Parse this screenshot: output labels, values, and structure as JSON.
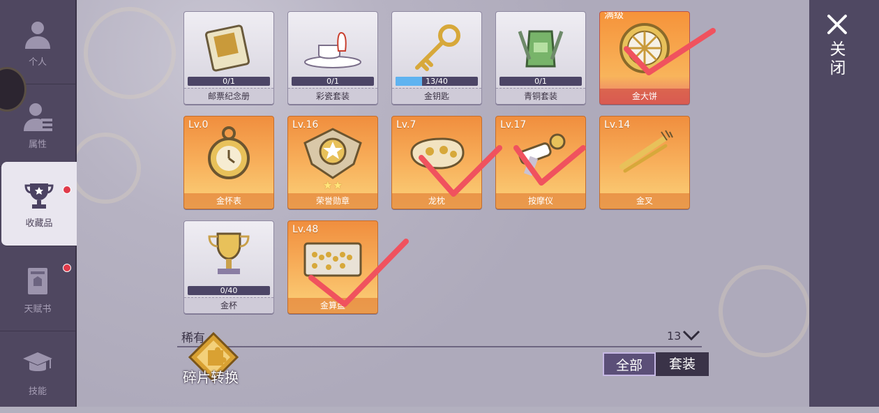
{
  "sidebar": {
    "items": [
      {
        "label": "个人",
        "icon": "person-icon"
      },
      {
        "label": "属性",
        "icon": "person-stats-icon"
      },
      {
        "label": "收藏品",
        "icon": "trophy-icon"
      },
      {
        "label": "天赋书",
        "icon": "book-icon"
      },
      {
        "label": "技能",
        "icon": "graduation-cap-icon"
      }
    ]
  },
  "close": {
    "label": "关闭",
    "icon": "close-icon"
  },
  "collection": {
    "row1": [
      {
        "name": "邮票纪念册",
        "progress": "0/1",
        "fill": 0
      },
      {
        "name": "彩瓷套装",
        "progress": "0/1",
        "fill": 0
      },
      {
        "name": "金钥匙",
        "progress": "13/40",
        "fill": 0.325
      },
      {
        "name": "青铜套装",
        "progress": "0/1",
        "fill": 0
      },
      {
        "name": "金大饼",
        "tag": "满级"
      }
    ],
    "row2": [
      {
        "name": "金怀表",
        "level": "Lv.0"
      },
      {
        "name": "荣誉勋章",
        "level": "Lv.16",
        "stars": "★★"
      },
      {
        "name": "龙枕",
        "level": "Lv.7"
      },
      {
        "name": "按摩仪",
        "level": "Lv.17"
      },
      {
        "name": "金叉",
        "level": "Lv.14"
      }
    ],
    "row3": [
      {
        "name": "金杯",
        "progress": "0/40",
        "fill": 0
      },
      {
        "name": "金算盘",
        "level": "Lv.48"
      }
    ]
  },
  "footer": {
    "rarity_label": "稀有",
    "rarity_count": "13",
    "fragment_button": "碎片转换",
    "tab_all": "全部",
    "tab_set": "套装"
  },
  "colors": {
    "accent": "#f29a45",
    "tick": "#f0525e",
    "sidebar": "#4f4760"
  }
}
